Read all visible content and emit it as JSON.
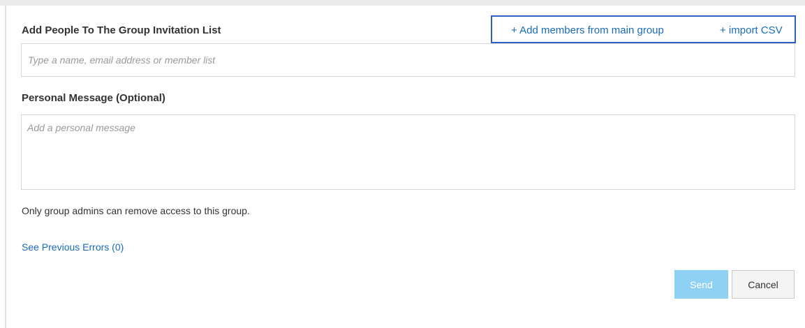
{
  "invite": {
    "heading": "Add People To The Group Invitation List",
    "input_placeholder": "Type a name, email address or member list",
    "input_value": ""
  },
  "actions": {
    "add_from_main_label": "+ Add members from main group",
    "import_csv_label": "+ import CSV"
  },
  "message": {
    "heading": "Personal Message (Optional)",
    "placeholder": "Add a personal message",
    "value": ""
  },
  "note": "Only group admins can remove access to this group.",
  "errors_link": "See Previous Errors (0)",
  "buttons": {
    "send_label": "Send",
    "cancel_label": "Cancel"
  },
  "colors": {
    "link": "#1a6bb8",
    "highlight_border": "#2f5fc4",
    "send_disabled": "#8fd1f2"
  }
}
